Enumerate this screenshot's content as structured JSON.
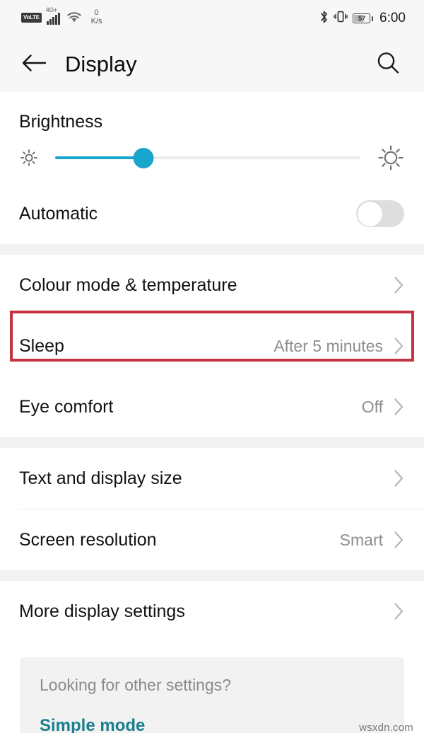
{
  "status_bar": {
    "volte_label": "VoLTE",
    "network_gen": "4G+",
    "data_rate_value": "0",
    "data_rate_unit": "K/s",
    "battery_percent": "57",
    "time": "6:00",
    "icons": [
      "volte-icon",
      "signal-bars-icon",
      "wifi-icon",
      "bluetooth-icon",
      "vibrate-icon",
      "battery-icon"
    ]
  },
  "header": {
    "title": "Display",
    "back_icon": "back-arrow-icon",
    "search_icon": "search-icon"
  },
  "brightness": {
    "title": "Brightness",
    "slider_value": 29,
    "low_icon": "brightness-low-sun-icon",
    "high_icon": "brightness-high-sun-icon",
    "accent_color": "#19a5cc"
  },
  "automatic": {
    "label": "Automatic",
    "toggle_state": "off"
  },
  "sections": [
    {
      "rows": [
        {
          "label": "Colour mode & temperature",
          "value": "",
          "chevron": true
        },
        {
          "label": "Sleep",
          "value": "After 5 minutes",
          "chevron": true,
          "highlighted": true
        },
        {
          "label": "Eye comfort",
          "value": "Off",
          "chevron": true
        }
      ]
    },
    {
      "rows": [
        {
          "label": "Text and display size",
          "value": "",
          "chevron": true
        },
        {
          "label": "Screen resolution",
          "value": "Smart",
          "chevron": true
        }
      ]
    },
    {
      "rows": [
        {
          "label": "More display settings",
          "value": "",
          "chevron": true
        }
      ]
    }
  ],
  "footer": {
    "question": "Looking for other settings?",
    "link_label": "Simple mode",
    "link_color": "#1a7f8e",
    "watermark": "wsxdn.com"
  },
  "annotation": {
    "color": "#c4333f",
    "target": "Sleep"
  }
}
